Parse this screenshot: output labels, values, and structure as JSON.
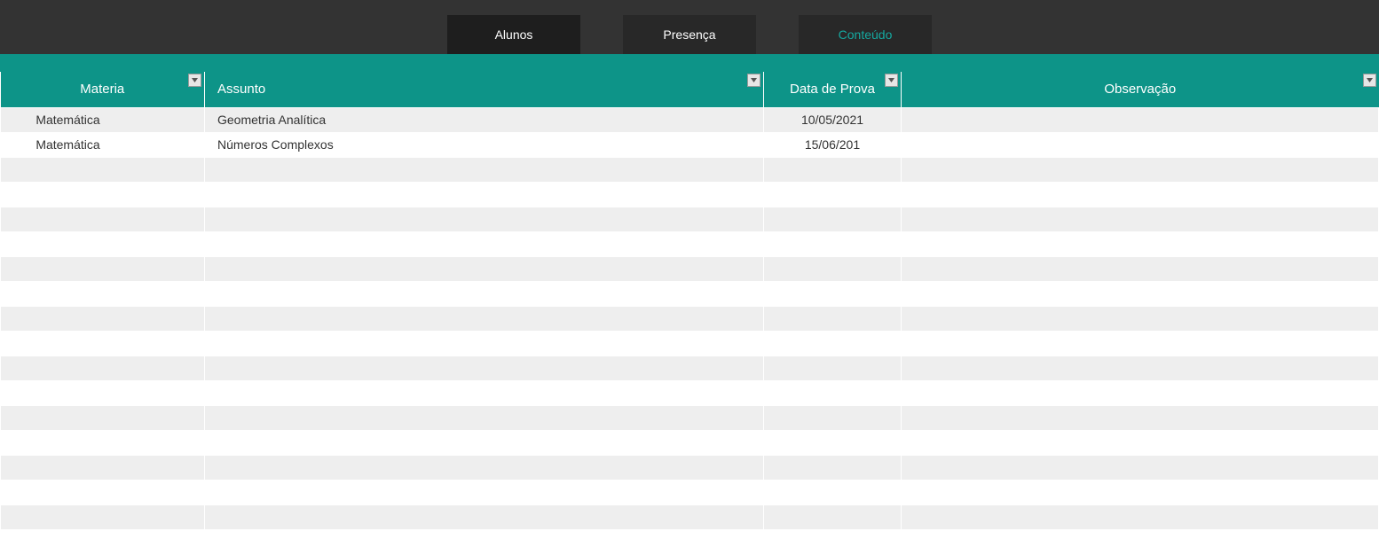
{
  "tabs": {
    "alunos": {
      "label": "Alunos"
    },
    "presenca": {
      "label": "Presença"
    },
    "conteudo": {
      "label": "Conteúdo"
    }
  },
  "columns": {
    "materia": {
      "label": "Materia"
    },
    "assunto": {
      "label": "Assunto"
    },
    "data_prova": {
      "label": "Data de Prova"
    },
    "observacao": {
      "label": "Observação"
    }
  },
  "rows": [
    {
      "materia": "Matemática",
      "assunto": "Geometria Analítica",
      "data_prova": "10/05/2021",
      "observacao": ""
    },
    {
      "materia": "Matemática",
      "assunto": "Números Complexos",
      "data_prova": "15/06/201",
      "observacao": ""
    },
    {
      "materia": "",
      "assunto": "",
      "data_prova": "",
      "observacao": ""
    },
    {
      "materia": "",
      "assunto": "",
      "data_prova": "",
      "observacao": ""
    },
    {
      "materia": "",
      "assunto": "",
      "data_prova": "",
      "observacao": ""
    },
    {
      "materia": "",
      "assunto": "",
      "data_prova": "",
      "observacao": ""
    },
    {
      "materia": "",
      "assunto": "",
      "data_prova": "",
      "observacao": ""
    },
    {
      "materia": "",
      "assunto": "",
      "data_prova": "",
      "observacao": ""
    },
    {
      "materia": "",
      "assunto": "",
      "data_prova": "",
      "observacao": ""
    },
    {
      "materia": "",
      "assunto": "",
      "data_prova": "",
      "observacao": ""
    },
    {
      "materia": "",
      "assunto": "",
      "data_prova": "",
      "observacao": ""
    },
    {
      "materia": "",
      "assunto": "",
      "data_prova": "",
      "observacao": ""
    },
    {
      "materia": "",
      "assunto": "",
      "data_prova": "",
      "observacao": ""
    },
    {
      "materia": "",
      "assunto": "",
      "data_prova": "",
      "observacao": ""
    },
    {
      "materia": "",
      "assunto": "",
      "data_prova": "",
      "observacao": ""
    },
    {
      "materia": "",
      "assunto": "",
      "data_prova": "",
      "observacao": ""
    },
    {
      "materia": "",
      "assunto": "",
      "data_prova": "",
      "observacao": ""
    },
    {
      "materia": "",
      "assunto": "",
      "data_prova": "",
      "observacao": ""
    }
  ],
  "colors": {
    "teal": "#0d9488",
    "header_bg": "#333333",
    "tab_bg": "#1e1e1e",
    "tab_active_text": "#15a9a0"
  }
}
